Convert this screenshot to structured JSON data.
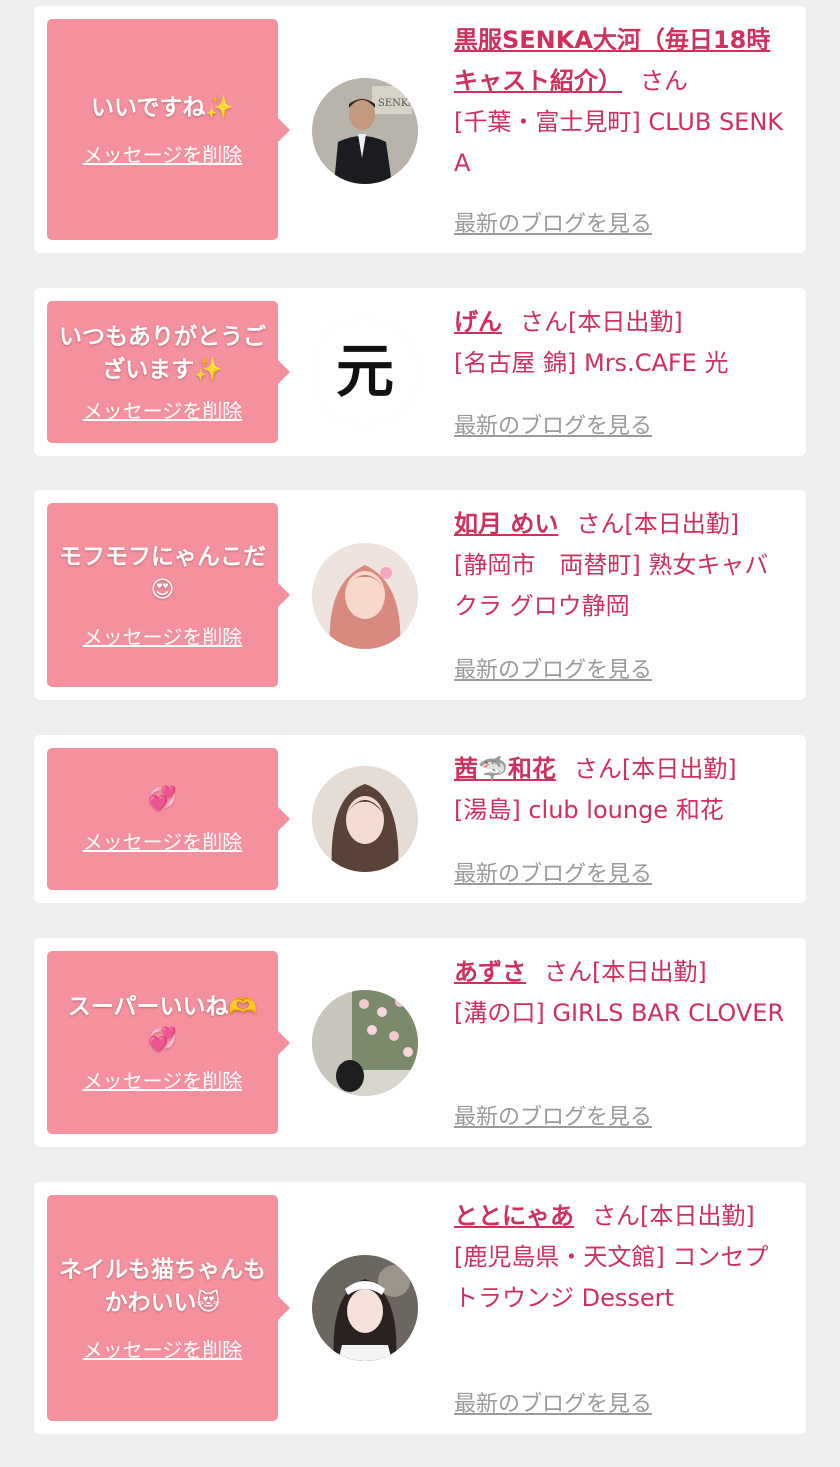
{
  "delete_label": "メッセージを削除",
  "blog_label": "最新のブログを見る",
  "san_suffix": "さん",
  "cards": [
    {
      "message": "いいですね✨",
      "name": "黒服SENKA大河（毎日18時キャスト紹介）",
      "status": "",
      "shop": "[千葉・富士見町] CLUB SENKA",
      "avatar": "man-in-suit"
    },
    {
      "message": "いつもありがとうございます✨",
      "name": "げん",
      "status": "[本日出勤]",
      "shop": "[名古屋 錦] Mrs.CAFE 光",
      "avatar": "calligraphy-logo",
      "avatar_text": "元"
    },
    {
      "message": "モフモフにゃんこだ😍",
      "name": "如月 めい",
      "status": "[本日出勤]",
      "shop": "[静岡市　両替町] 熟女キャバクラ グロウ静岡",
      "avatar": "woman-pink-hair"
    },
    {
      "message": "💞",
      "name": "茜🦈和花",
      "status": "[本日出勤]",
      "shop": "[湯島] club lounge 和花",
      "avatar": "woman-portrait"
    },
    {
      "message": "スーパーいいね🫶💞",
      "name": "あずさ",
      "status": "[本日出勤]",
      "shop": "[溝の口] GIRLS BAR CLOVER",
      "avatar": "flower-wall"
    },
    {
      "message": "ネイルも猫ちゃんもかわいい😻",
      "name": "ととにゃあ",
      "status": "[本日出勤]",
      "shop": "[鹿児島県・天文館] コンセプトラウンジ Dessert",
      "avatar": "maid-costume"
    }
  ],
  "colors": {
    "bubble": "#f5909e",
    "accent": "#d0305c",
    "link_gray": "#9a9a9a",
    "background": "#eeeeee"
  }
}
